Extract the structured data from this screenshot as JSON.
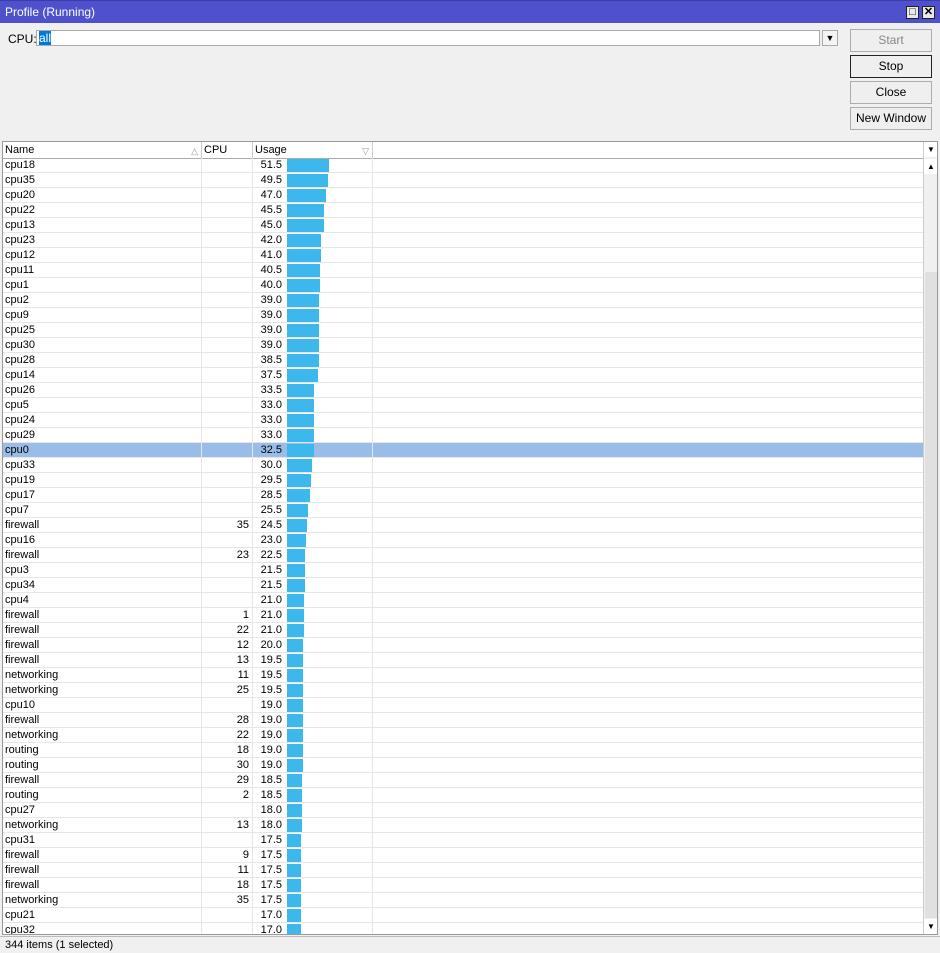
{
  "window": {
    "title": "Profile (Running)",
    "maximize_icon": "maximize-icon",
    "close_icon": "close-icon"
  },
  "filter": {
    "label": "CPU:",
    "value": "all"
  },
  "buttons": {
    "start": "Start",
    "stop": "Stop",
    "close": "Close",
    "new_window": "New Window"
  },
  "table": {
    "columns": [
      "Name",
      "CPU",
      "Usage"
    ],
    "sort": {
      "column": "Usage",
      "direction": "descending"
    },
    "bar_color": "#3db8ec",
    "rows": [
      [
        "cpu18",
        "",
        "51.5"
      ],
      [
        "cpu35",
        "",
        "49.5"
      ],
      [
        "cpu20",
        "",
        "47.0"
      ],
      [
        "cpu22",
        "",
        "45.5"
      ],
      [
        "cpu13",
        "",
        "45.0"
      ],
      [
        "cpu23",
        "",
        "42.0"
      ],
      [
        "cpu12",
        "",
        "41.0"
      ],
      [
        "cpu11",
        "",
        "40.5"
      ],
      [
        "cpu1",
        "",
        "40.0"
      ],
      [
        "cpu2",
        "",
        "39.0"
      ],
      [
        "cpu9",
        "",
        "39.0"
      ],
      [
        "cpu25",
        "",
        "39.0"
      ],
      [
        "cpu30",
        "",
        "39.0"
      ],
      [
        "cpu28",
        "",
        "38.5"
      ],
      [
        "cpu14",
        "",
        "37.5"
      ],
      [
        "cpu26",
        "",
        "33.5"
      ],
      [
        "cpu5",
        "",
        "33.0"
      ],
      [
        "cpu24",
        "",
        "33.0"
      ],
      [
        "cpu29",
        "",
        "33.0"
      ],
      [
        "cpu0",
        "",
        "32.5"
      ],
      [
        "cpu33",
        "",
        "30.0"
      ],
      [
        "cpu19",
        "",
        "29.5"
      ],
      [
        "cpu17",
        "",
        "28.5"
      ],
      [
        "cpu7",
        "",
        "25.5"
      ],
      [
        "firewall",
        "35",
        "24.5"
      ],
      [
        "cpu16",
        "",
        "23.0"
      ],
      [
        "firewall",
        "23",
        "22.5"
      ],
      [
        "cpu3",
        "",
        "21.5"
      ],
      [
        "cpu34",
        "",
        "21.5"
      ],
      [
        "cpu4",
        "",
        "21.0"
      ],
      [
        "firewall",
        "1",
        "21.0"
      ],
      [
        "firewall",
        "22",
        "21.0"
      ],
      [
        "firewall",
        "12",
        "20.0"
      ],
      [
        "firewall",
        "13",
        "19.5"
      ],
      [
        "networking",
        "11",
        "19.5"
      ],
      [
        "networking",
        "25",
        "19.5"
      ],
      [
        "cpu10",
        "",
        "19.0"
      ],
      [
        "firewall",
        "28",
        "19.0"
      ],
      [
        "networking",
        "22",
        "19.0"
      ],
      [
        "routing",
        "18",
        "19.0"
      ],
      [
        "routing",
        "30",
        "19.0"
      ],
      [
        "firewall",
        "29",
        "18.5"
      ],
      [
        "routing",
        "2",
        "18.5"
      ],
      [
        "cpu27",
        "",
        "18.0"
      ],
      [
        "networking",
        "13",
        "18.0"
      ],
      [
        "cpu31",
        "",
        "17.5"
      ],
      [
        "firewall",
        "9",
        "17.5"
      ],
      [
        "firewall",
        "11",
        "17.5"
      ],
      [
        "firewall",
        "18",
        "17.5"
      ],
      [
        "networking",
        "35",
        "17.5"
      ],
      [
        "cpu21",
        "",
        "17.0"
      ],
      [
        "cpu32",
        "",
        "17.0"
      ]
    ],
    "selected_index": 19
  },
  "status": "344 items (1 selected)"
}
